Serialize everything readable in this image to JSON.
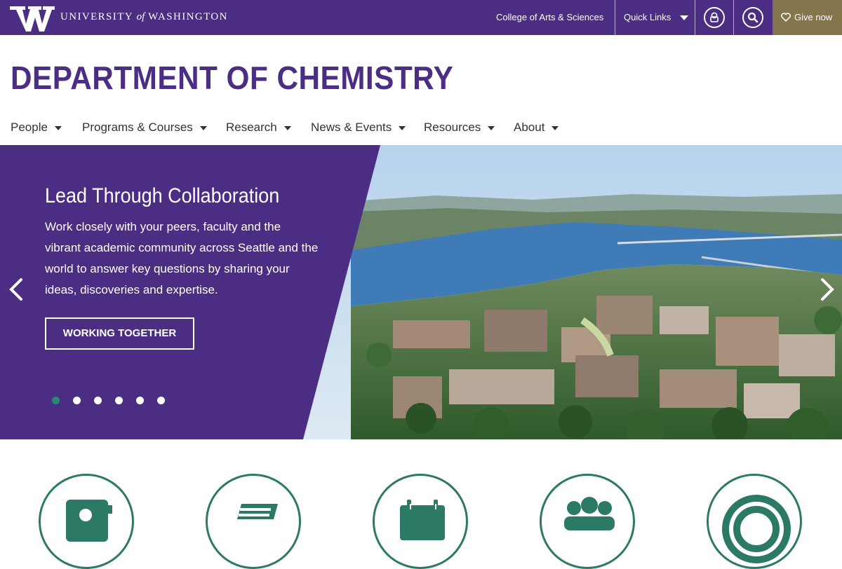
{
  "topbar": {
    "logo_letter": "W",
    "wordmark_pre": "UNIVERSITY",
    "wordmark_of": "of",
    "wordmark_post": "WASHINGTON",
    "college_link": "College of Arts & Sciences",
    "quick_links": "Quick Links",
    "give_label": "Give now",
    "bg_color": "#4b2e83",
    "give_color": "#85754d",
    "icons": [
      "user-icon",
      "search-icon",
      "heart-icon",
      "caret-down-icon"
    ]
  },
  "header": {
    "title": "DEPARTMENT OF CHEMISTRY"
  },
  "nav": {
    "items": [
      {
        "label": "People"
      },
      {
        "label": "Programs & Courses"
      },
      {
        "label": "Research"
      },
      {
        "label": "News & Events"
      },
      {
        "label": "Resources"
      },
      {
        "label": "About"
      }
    ]
  },
  "hero": {
    "heading": "Lead Through Collaboration",
    "body": "Work closely with your peers, faculty and the vibrant academic community across Seattle and the world to answer key questions by sharing your ideas, discoveries and expertise.",
    "button_label": "WORKING TOGETHER",
    "slide_count": 6,
    "active_slide": 1,
    "panel_color": "#4b2e83",
    "active_dot_color": "#2a8a6e"
  },
  "features": {
    "icons": [
      "contact-card-icon",
      "books-icon",
      "calendar-icon",
      "people-group-icon",
      "target-icon"
    ],
    "accent_color": "#2c7a66"
  }
}
